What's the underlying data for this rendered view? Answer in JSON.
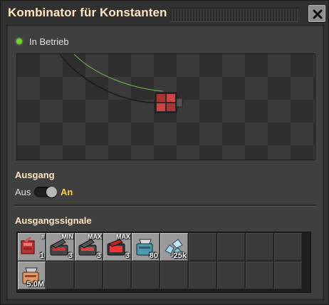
{
  "window": {
    "title": "Kombinator für Konstanten"
  },
  "status": {
    "text": "In Betrieb",
    "color": "#6fd12e"
  },
  "output": {
    "section_label": "Ausgang",
    "off_label": "Aus",
    "on_label": "An",
    "enabled": true
  },
  "signals": {
    "section_label": "Ausgangssignale",
    "slots": [
      {
        "icon": "constant-combinator-icon",
        "count": "1",
        "tag": "#"
      },
      {
        "icon": "inserter-min-icon",
        "count": "3",
        "tag": "MIN"
      },
      {
        "icon": "inserter-max-icon",
        "count": "3",
        "tag": "MAX"
      },
      {
        "icon": "inserter-max-red-icon",
        "count": "3",
        "tag": "MAX"
      },
      {
        "icon": "robot-chest-icon",
        "count": "80",
        "tag": ""
      },
      {
        "icon": "ore-chunks-icon",
        "count": "-25k",
        "tag": ""
      },
      {
        "icon": "",
        "count": "",
        "tag": ""
      },
      {
        "icon": "",
        "count": "",
        "tag": ""
      },
      {
        "icon": "",
        "count": "",
        "tag": ""
      },
      {
        "icon": "",
        "count": "",
        "tag": ""
      },
      {
        "icon": "roboport-icon",
        "count": "5.0M",
        "tag": ""
      },
      {
        "icon": "",
        "count": "",
        "tag": ""
      },
      {
        "icon": "",
        "count": "",
        "tag": ""
      },
      {
        "icon": "",
        "count": "",
        "tag": ""
      },
      {
        "icon": "",
        "count": "",
        "tag": ""
      },
      {
        "icon": "",
        "count": "",
        "tag": ""
      },
      {
        "icon": "",
        "count": "",
        "tag": ""
      },
      {
        "icon": "",
        "count": "",
        "tag": ""
      },
      {
        "icon": "",
        "count": "",
        "tag": ""
      },
      {
        "icon": "",
        "count": "",
        "tag": ""
      }
    ]
  }
}
